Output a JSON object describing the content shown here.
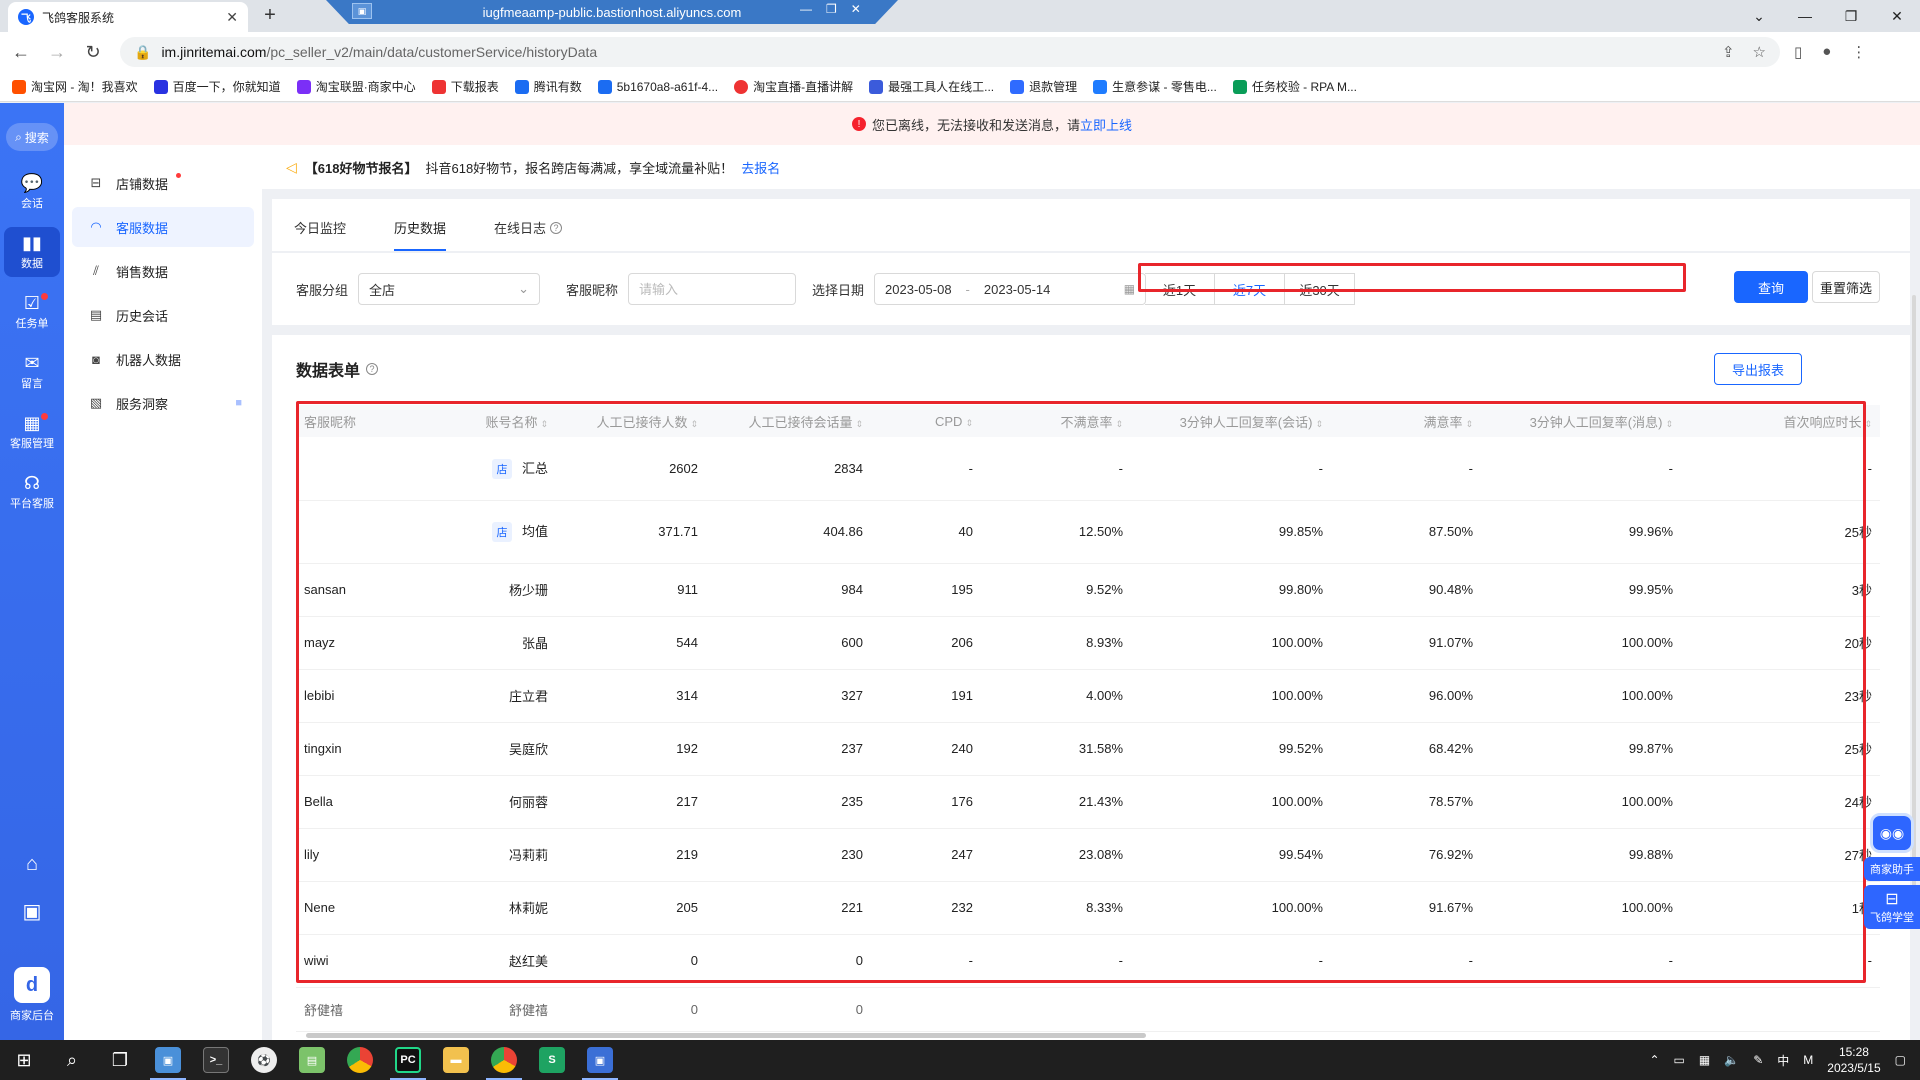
{
  "browser": {
    "tab_title": "飞鸽客服系统",
    "rdp_title": "iugfmeaamp-public.bastionhost.aliyuncs.com",
    "url_host": "im.jinritemai.com",
    "url_path": "/pc_seller_v2/main/data/customerService/historyData",
    "bookmarks": [
      "淘宝网 - 淘！我喜欢",
      "百度一下，你就知道",
      "淘宝联盟·商家中心",
      "下载报表",
      "腾讯有数",
      "5b1670a8-a61f-4...",
      "淘宝直播-直播讲解",
      "最强工具人在线工...",
      "退款管理",
      "生意参谋 - 零售电...",
      "任务校验 - RPA M..."
    ]
  },
  "rail": {
    "search": "搜索",
    "items": [
      "会话",
      "数据",
      "任务单",
      "留言",
      "客服管理",
      "平台客服"
    ],
    "logo_label": "商家后台"
  },
  "notice": {
    "text": "您已离线，无法接收和发送消息，请",
    "link": "立即上线"
  },
  "sidebar": {
    "items": [
      "店铺数据",
      "客服数据",
      "销售数据",
      "历史会话",
      "机器人数据",
      "服务洞察"
    ]
  },
  "promo": {
    "tag": "【618好物节报名】",
    "text": "抖音618好物节，报名跨店每满减，享全域流量补贴！",
    "link": "去报名"
  },
  "tabs": [
    "今日监控",
    "历史数据",
    "在线日志"
  ],
  "filters": {
    "group_label": "客服分组",
    "group_value": "全店",
    "nick_label": "客服昵称",
    "nick_placeholder": "请输入",
    "date_label": "选择日期",
    "date_start": "2023-05-08",
    "date_end": "2023-05-14",
    "date_sep": "-",
    "quick": [
      "近1天",
      "近7天",
      "近30天"
    ],
    "query": "查询",
    "reset": "重置筛选"
  },
  "panel": {
    "title": "数据表单",
    "export": "导出报表"
  },
  "table": {
    "columns": [
      "客服昵称",
      "账号名称",
      "人工已接待人数",
      "人工已接待会话量",
      "CPD",
      "不满意率",
      "3分钟人工回复率(会话)",
      "满意率",
      "3分钟人工回复率(消息)",
      "首次响应时长"
    ],
    "store_badge": "店",
    "summary": [
      {
        "name": "汇总",
        "c1": "2602",
        "c2": "2834",
        "c3": "-",
        "c4": "-",
        "c5": "-",
        "c6": "-",
        "c7": "-",
        "c8": "-"
      },
      {
        "name": "均值",
        "c1": "371.71",
        "c2": "404.86",
        "c3": "40",
        "c4": "12.50%",
        "c5": "99.85%",
        "c6": "87.50%",
        "c7": "99.96%",
        "c8": "25秒"
      }
    ],
    "rows": [
      {
        "nick": "sansan",
        "acct": "杨少珊",
        "c1": "911",
        "c2": "984",
        "c3": "195",
        "c4": "9.52%",
        "c5": "99.80%",
        "c6": "90.48%",
        "c7": "99.95%",
        "c8": "3秒"
      },
      {
        "nick": "mayz",
        "acct": "张晶",
        "c1": "544",
        "c2": "600",
        "c3": "206",
        "c4": "8.93%",
        "c5": "100.00%",
        "c6": "91.07%",
        "c7": "100.00%",
        "c8": "20秒"
      },
      {
        "nick": "lebibi",
        "acct": "庄立君",
        "c1": "314",
        "c2": "327",
        "c3": "191",
        "c4": "4.00%",
        "c5": "100.00%",
        "c6": "96.00%",
        "c7": "100.00%",
        "c8": "23秒"
      },
      {
        "nick": "tingxin",
        "acct": "吴庭欣",
        "c1": "192",
        "c2": "237",
        "c3": "240",
        "c4": "31.58%",
        "c5": "99.52%",
        "c6": "68.42%",
        "c7": "99.87%",
        "c8": "25秒"
      },
      {
        "nick": "Bella",
        "acct": "何丽蓉",
        "c1": "217",
        "c2": "235",
        "c3": "176",
        "c4": "21.43%",
        "c5": "100.00%",
        "c6": "78.57%",
        "c7": "100.00%",
        "c8": "24秒"
      },
      {
        "nick": "lily",
        "acct": "冯莉莉",
        "c1": "219",
        "c2": "230",
        "c3": "247",
        "c4": "23.08%",
        "c5": "99.54%",
        "c6": "76.92%",
        "c7": "99.88%",
        "c8": "27秒"
      },
      {
        "nick": "Nene",
        "acct": "林莉妮",
        "c1": "205",
        "c2": "221",
        "c3": "232",
        "c4": "8.33%",
        "c5": "100.00%",
        "c6": "91.67%",
        "c7": "100.00%",
        "c8": "1秒"
      },
      {
        "nick": "wiwi",
        "acct": "赵红美",
        "c1": "0",
        "c2": "0",
        "c3": "-",
        "c4": "-",
        "c5": "-",
        "c6": "-",
        "c7": "-",
        "c8": "-"
      }
    ],
    "partial": {
      "nick": "舒健禧",
      "acct": "舒健禧",
      "c1": "0",
      "c2": "0"
    }
  },
  "assist": {
    "merchant": "商家助手",
    "academy": "飞鸽学堂"
  },
  "taskbar": {
    "time": "15:28",
    "date": "2023/5/15",
    "ime": "中"
  },
  "colors": {
    "primary": "#1966ff",
    "rail": "#3566e6",
    "alert_red": "#f5222d",
    "highlight_red": "#e8252b"
  }
}
